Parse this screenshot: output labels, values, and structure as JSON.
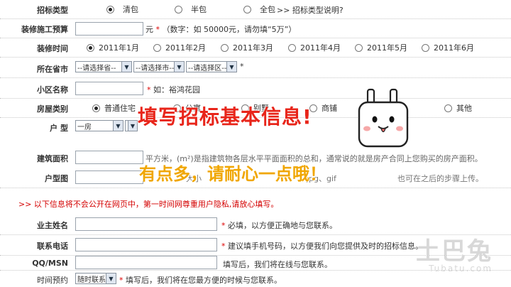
{
  "fields": {
    "bid_type": {
      "label": "招标类型",
      "options": [
        "清包",
        "半包",
        "全包"
      ],
      "selected": 0,
      "link": ">> 招标类型说明?"
    },
    "budget": {
      "label": "装修施工预算",
      "unit": "元",
      "hint": "（数字：如 50000元，请勿填“5万”）"
    },
    "time": {
      "label": "装修时间",
      "options": [
        "2011年1月",
        "2011年2月",
        "2011年3月",
        "2011年4月",
        "2011年5月",
        "2011年6月"
      ],
      "selected": 0
    },
    "province": {
      "label": "所在省市",
      "province": "--请选择省--",
      "city": "--请选择市--",
      "district": "--请选择区--"
    },
    "community": {
      "label": "小区名称",
      "hint": "如：裕鸿花园"
    },
    "house_type": {
      "label": "房屋类别",
      "options": [
        "普通住宅",
        "公寓",
        "别墅",
        "商铺",
        "其他"
      ],
      "selected": 0
    },
    "layout": {
      "label": "户 型",
      "select1": "一房"
    },
    "area": {
      "label": "建筑面积",
      "hint": "平方米，(m²)是指建筑物各层水平平面面积的总和，通常说的就是房产合同上您购买的房产面积。"
    },
    "floorplan": {
      "label": "户型图",
      "hint_left": "大小",
      "hint_mid": "jpg、gif",
      "hint_right": "也可在之后的步骤上传。"
    },
    "privacy_notice": ">> 以下信息将不会公开在网页中，第一时间网尊重用户隐私,请放心填写。",
    "owner_name": {
      "label": "业主姓名",
      "hint": "必填，以方便正确地与您联系。"
    },
    "phone": {
      "label": "联系电话",
      "hint": "建议填手机号码，以方便我们向您提供及时的招标信息。"
    },
    "qq": {
      "label": "QQ/MSN",
      "hint": "填写后，我们将在线与您联系。"
    },
    "appointment": {
      "label": "时间预约",
      "select": "随时联系",
      "hint": "填写后，我们将在您最方便的时候与您联系。"
    }
  },
  "overlay": {
    "title": "填写招标基本信息!",
    "subtitle": "有点多，请耐心一点哦！"
  },
  "watermark": {
    "cn": "土巴兔",
    "en": "Tubatu.com"
  },
  "colors": {
    "required": "#dd0000",
    "overlay_title": "#e8251a",
    "overlay_sub": "#f0a600"
  }
}
